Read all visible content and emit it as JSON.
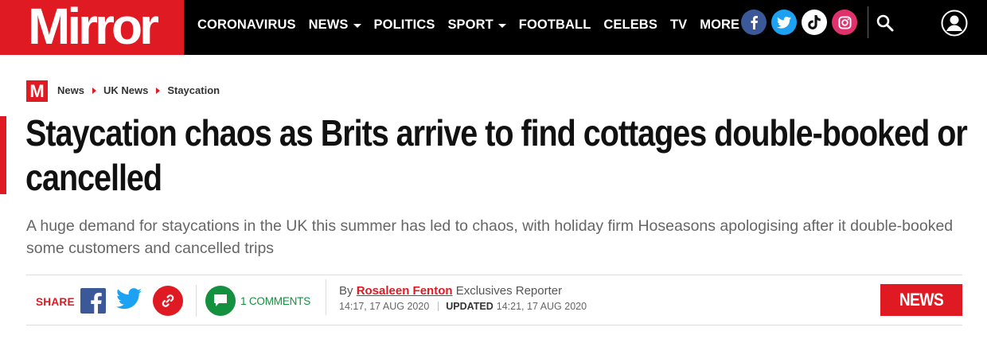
{
  "brand": {
    "logo_text": "Mirror",
    "mark_letter": "M",
    "accent_color": "#e01a22",
    "comments_color": "#14913f"
  },
  "nav": {
    "items": [
      {
        "label": "CORONAVIRUS",
        "dropdown": false
      },
      {
        "label": "NEWS",
        "dropdown": true
      },
      {
        "label": "POLITICS",
        "dropdown": false
      },
      {
        "label": "SPORT",
        "dropdown": true
      },
      {
        "label": "FOOTBALL",
        "dropdown": false
      },
      {
        "label": "CELEBS",
        "dropdown": false
      },
      {
        "label": "TV",
        "dropdown": false
      },
      {
        "label": "MORE",
        "dropdown": true
      }
    ],
    "social": [
      {
        "name": "facebook-icon",
        "color": "#3b5998"
      },
      {
        "name": "twitter-icon",
        "color": "#1da1f2"
      },
      {
        "name": "tiktok-icon",
        "color": "#ffffff"
      },
      {
        "name": "instagram-icon",
        "color": "#e1306c"
      }
    ],
    "search_icon": "search-icon",
    "account_icon": "account-icon"
  },
  "breadcrumb": [
    "News",
    "UK News",
    "Staycation"
  ],
  "article": {
    "headline": "Staycation chaos as Brits arrive to find cottages double-booked or cancelled",
    "standfirst": "A huge demand for staycations in the UK this summer has led to chaos, with holiday firm Hoseasons apologising after it double-booked some customers and cancelled trips",
    "share_label": "SHARE",
    "comments_count": "1",
    "comments_label": "COMMENTS",
    "byline_prefix": "By",
    "author": "Rosaleen Fenton",
    "author_role": "Exclusives Reporter",
    "published": "14:17, 17 AUG 2020",
    "updated_label": "UPDATED",
    "updated": "14:21, 17 AUG 2020",
    "section_badge": "NEWS"
  }
}
